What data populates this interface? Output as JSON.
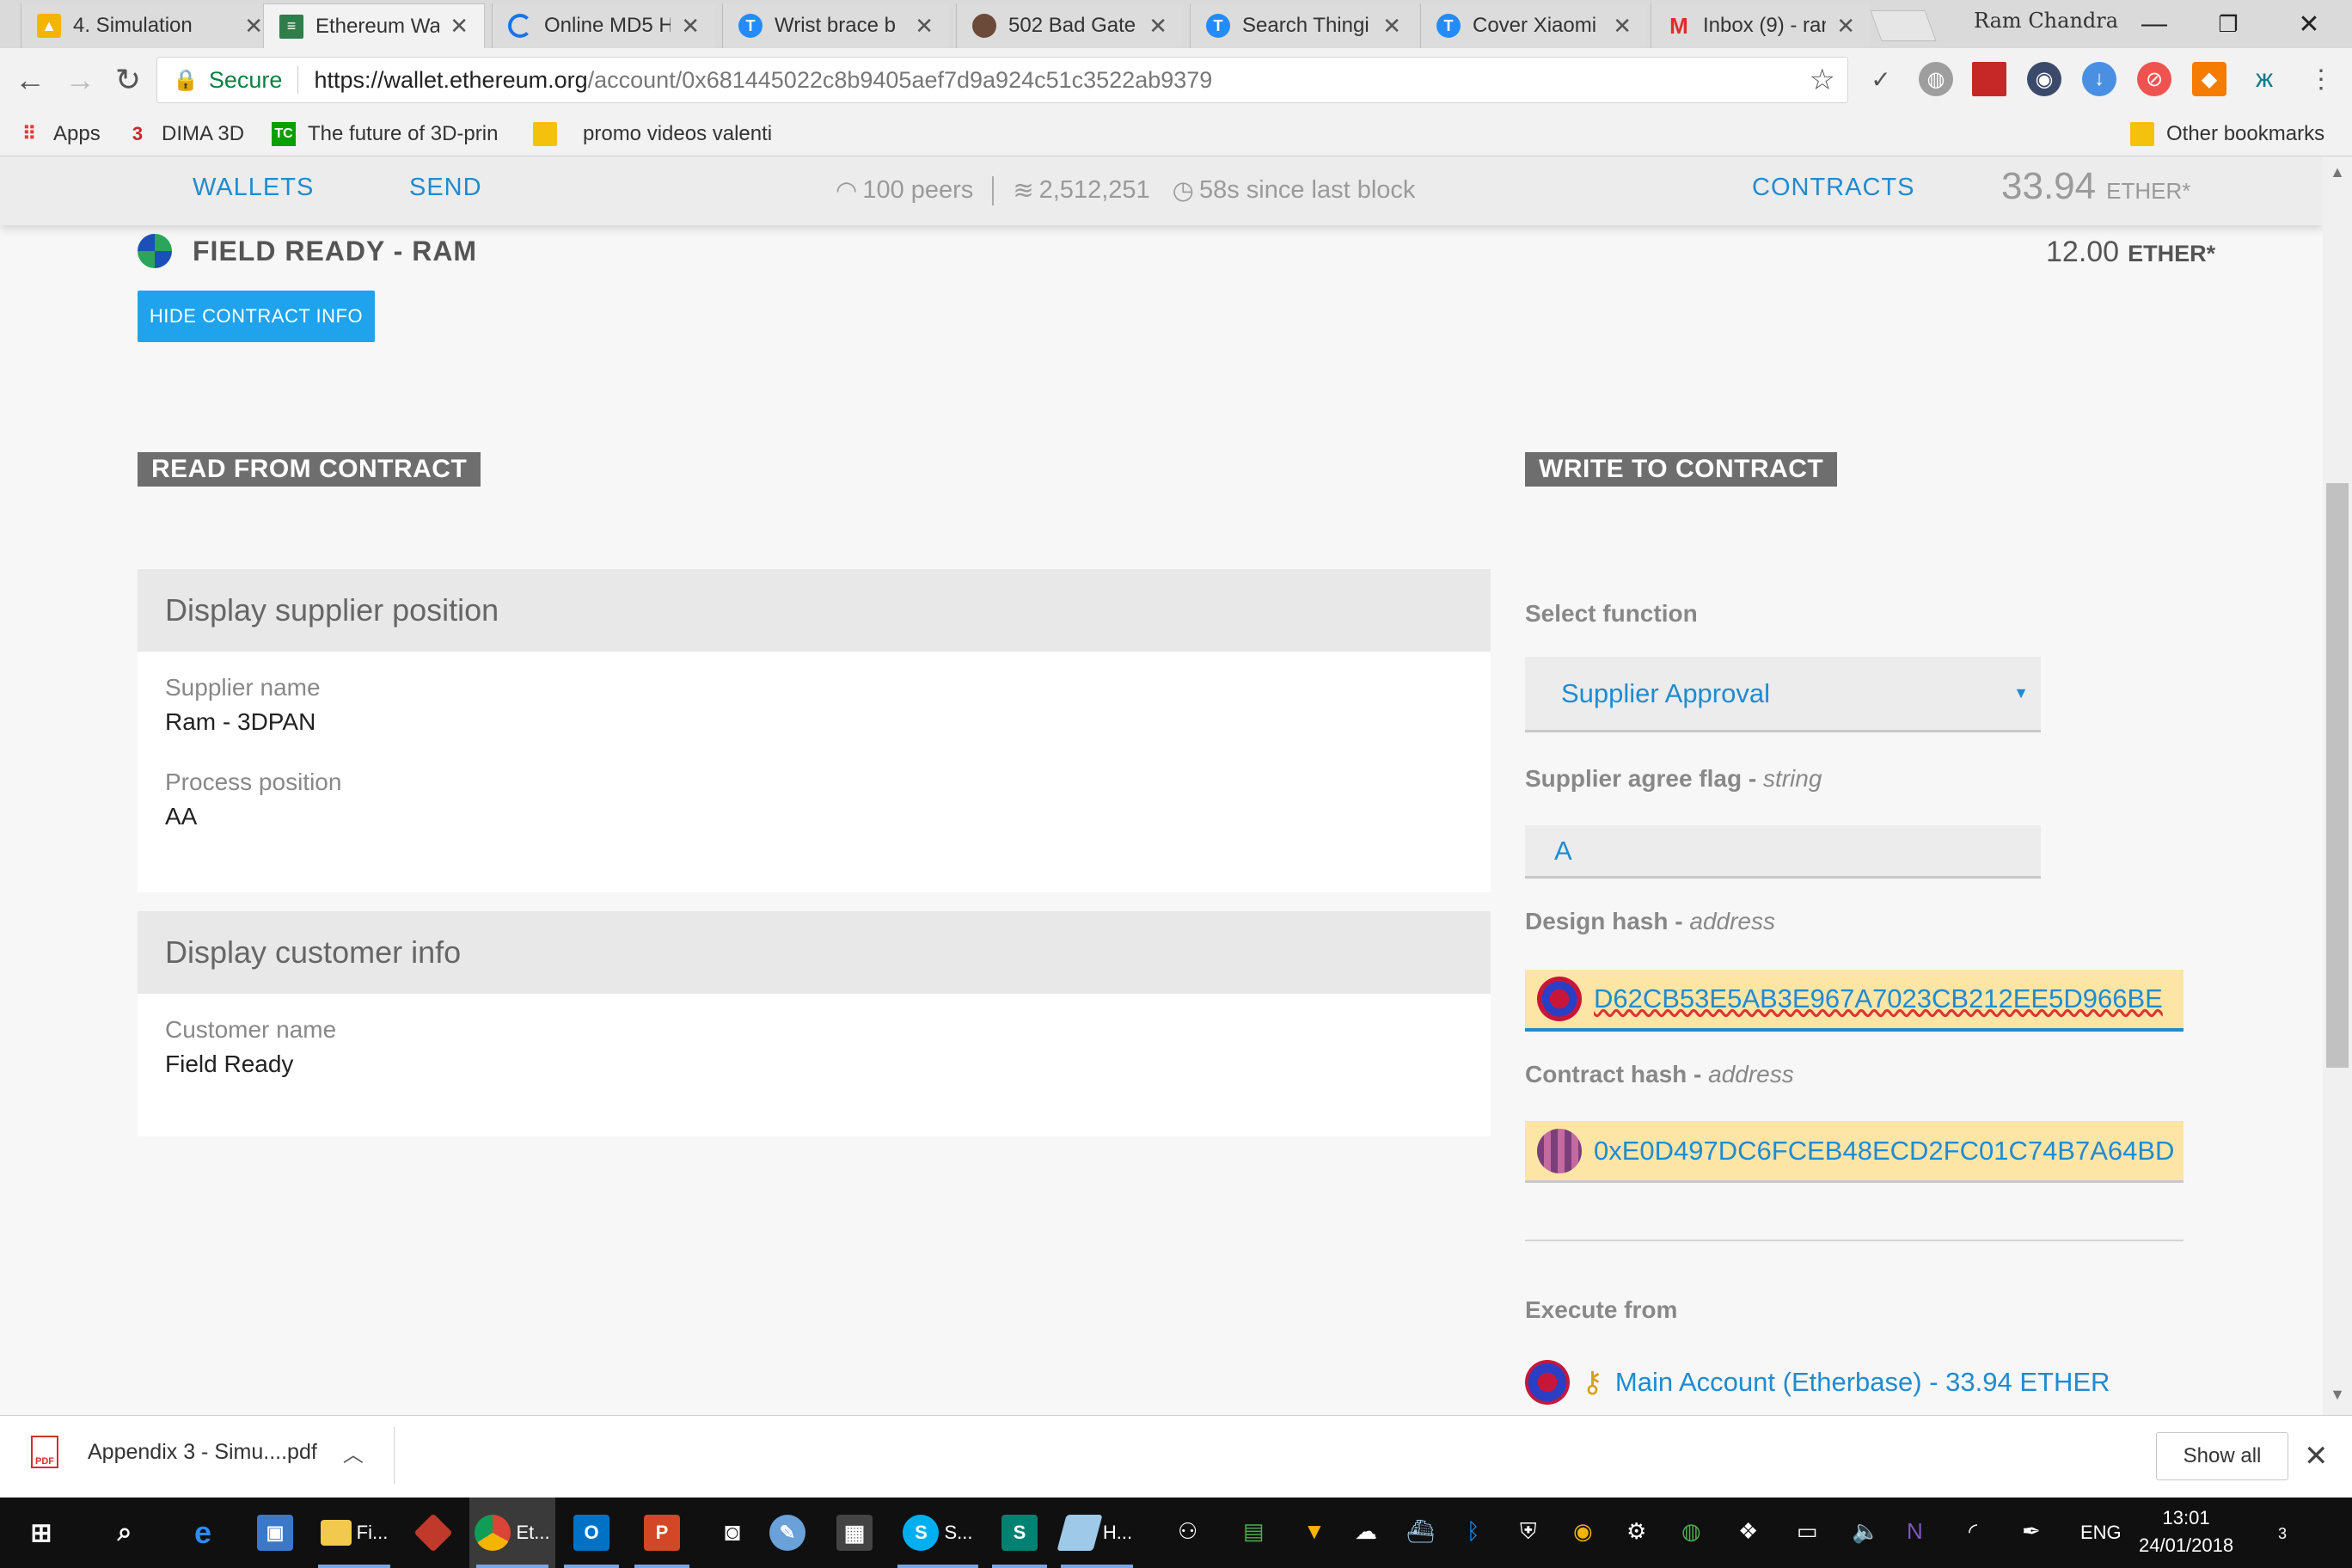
{
  "browser": {
    "tabs": [
      {
        "label": "4. Simulation",
        "icon": "drive-icon",
        "color": "#f4b400"
      },
      {
        "label": "Ethereum Wal",
        "icon": "ethereum-wallet-icon",
        "color": "#2f7d4b"
      },
      {
        "label": "Online MD5 H",
        "icon": "loading-spinner-icon",
        "color": "#1a73e8"
      },
      {
        "label": "Wrist brace b",
        "icon": "thingiverse-icon",
        "color": "#248bfb"
      },
      {
        "label": "502 Bad Gate",
        "icon": "site-avatar-icon",
        "color": "#6b4a3a"
      },
      {
        "label": "Search Thingi",
        "icon": "thingiverse-icon",
        "color": "#248bfb"
      },
      {
        "label": "Cover Xiaomi",
        "icon": "thingiverse-icon",
        "color": "#248bfb"
      },
      {
        "label": "Inbox (9) - ran",
        "icon": "gmail-icon",
        "color": "#d93025"
      }
    ],
    "profile_name": "Ram Chandra",
    "address": {
      "secure_label": "Secure",
      "scheme_host": "https://wallet.ethereum.org",
      "path": "/account/0x681445022c8b9405aef7d9a924c51c3522ab9379"
    },
    "bookmarks": [
      {
        "label": "Apps",
        "icon": "apps-grid-icon"
      },
      {
        "label": "DIMA 3D",
        "icon": "dima3d-icon"
      },
      {
        "label": "The future of 3D-prin",
        "icon": "techcrunch-icon"
      },
      {
        "label": "promo videos valenti",
        "icon": "folder-icon"
      }
    ],
    "other_bookmarks": "Other bookmarks"
  },
  "wallet": {
    "nav": {
      "wallets": "WALLETS",
      "send": "SEND",
      "contracts": "CONTRACTS"
    },
    "network": {
      "peers": "100 peers",
      "block": "2,512,251",
      "since": "58s since last block"
    },
    "balance": {
      "amount": "33.94",
      "unit": "ETHER*"
    },
    "contract": {
      "name": "FIELD READY - RAM",
      "balance": "12.00",
      "balance_unit": "ETHER*",
      "hide_button": "HIDE CONTRACT INFO"
    },
    "read": {
      "title": "READ FROM CONTRACT",
      "cards": [
        {
          "heading": "Display supplier position",
          "fields": [
            {
              "label": "Supplier name",
              "value": "Ram - 3DPAN"
            },
            {
              "label": "Process position",
              "value": "AA"
            }
          ]
        },
        {
          "heading": "Display customer info",
          "fields": [
            {
              "label": "Customer name",
              "value": "Field Ready"
            }
          ]
        }
      ]
    },
    "write": {
      "title": "WRITE TO CONTRACT",
      "select_label": "Select function",
      "selected_function": "Supplier Approval",
      "flag_label": "Supplier agree flag - ",
      "flag_type": "string",
      "flag_value": "A",
      "design_label": "Design hash - ",
      "design_type": "address",
      "design_value": "D62CB53E5AB3E967A7023CB212EE5D966BE",
      "contract_label": "Contract hash - ",
      "contract_type": "address",
      "contract_value": "0xE0D497DC6FCEB48ECD2FC01C74B7A64BD",
      "execute_label": "Execute from",
      "execute_account": "Main Account (Etherbase) - 33.94 ETHER"
    }
  },
  "downloads": {
    "file": "Appendix 3 - Simu....pdf",
    "show_all": "Show all"
  },
  "taskbar": {
    "explorer_label": "Fi...",
    "chrome_label": "Et...",
    "skype_label": "S...",
    "h_label": "H...",
    "lang": "ENG",
    "time": "13:01",
    "date": "24/01/2018",
    "notifications": "3"
  }
}
